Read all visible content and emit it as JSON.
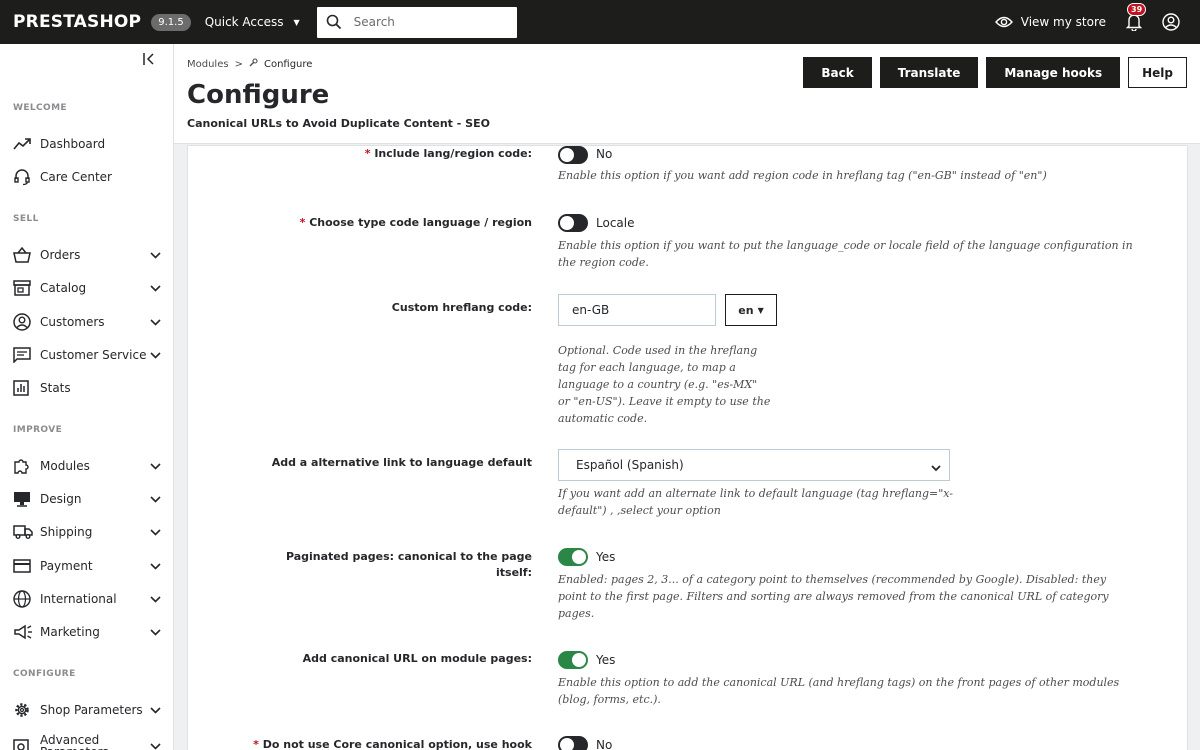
{
  "header": {
    "logo": "PRESTASHOP",
    "version": "9.1.5",
    "quick_access": "Quick Access",
    "search_placeholder": "Search",
    "view_store": "View my store",
    "notifications_count": "39"
  },
  "sidebar": {
    "sections": {
      "welcome": "WELCOME",
      "sell": "SELL",
      "improve": "IMPROVE",
      "configure": "CONFIGURE"
    },
    "items": {
      "dashboard": "Dashboard",
      "care_center": "Care Center",
      "orders": "Orders",
      "catalog": "Catalog",
      "customers": "Customers",
      "customer_service": "Customer Service",
      "stats": "Stats",
      "modules": "Modules",
      "design": "Design",
      "shipping": "Shipping",
      "payment": "Payment",
      "international": "International",
      "marketing": "Marketing",
      "shop_parameters": "Shop Parameters",
      "advanced_parameters": "Advanced Parameters"
    }
  },
  "page": {
    "breadcrumb": [
      "Modules",
      ">",
      "Configure"
    ],
    "title": "Configure",
    "subtitle": "Canonical URLs to Avoid Duplicate Content - SEO",
    "buttons": {
      "back": "Back",
      "translate": "Translate",
      "manage_hooks": "Manage hooks",
      "help": "Help"
    }
  },
  "form": {
    "include_lang": {
      "required": "*",
      "label": "Include lang/region code:",
      "value": "No",
      "help": "Enable this option if you want add region code in hreflang tag  (\"en-GB\" instead of \"en\")"
    },
    "code_type": {
      "required": "*",
      "label": "Choose type code language / region",
      "value": "Locale",
      "help_1": "Enable this option if you want to put the language_code or locale field of the language configuration in",
      "help_2": "the region code."
    },
    "custom_hreflang": {
      "label": "Custom hreflang code:",
      "value": "en-GB",
      "lang": "en",
      "help_1": "Optional. Code used in the hreflang",
      "help_2": "tag for each language, to map a",
      "help_3": "language to a country (e.g. \"es-MX\"",
      "help_4": "or \"en-US\"). Leave it empty to use the",
      "help_5": "automatic code."
    },
    "alt_link": {
      "label": "Add a alternative link to language default",
      "value": "Español (Spanish)",
      "help_1": "If you want add an alternate link to default language  (tag hreflang=\"x-",
      "help_2": "default\") , ,select your option"
    },
    "paginated": {
      "label_1": "Paginated pages: canonical to the page",
      "label_2": "itself:",
      "value": "Yes",
      "help_1": "Enabled: pages 2, 3... of a category point to themselves (recommended by Google). Disabled: they",
      "help_2": "point to the first page. Filters and sorting are always removed from the canonical URL of category",
      "help_3": "pages."
    },
    "module_pages": {
      "label": "Add canonical URL on module pages:",
      "value": "Yes",
      "help_1": "Enable this option to add the canonical URL (and hreflang tags) on the front pages of other modules",
      "help_2": "(blog, forms, etc.)."
    },
    "core_canonical": {
      "required": "*",
      "label": "Do not use Core canonical option, use hook",
      "value": "No"
    }
  }
}
